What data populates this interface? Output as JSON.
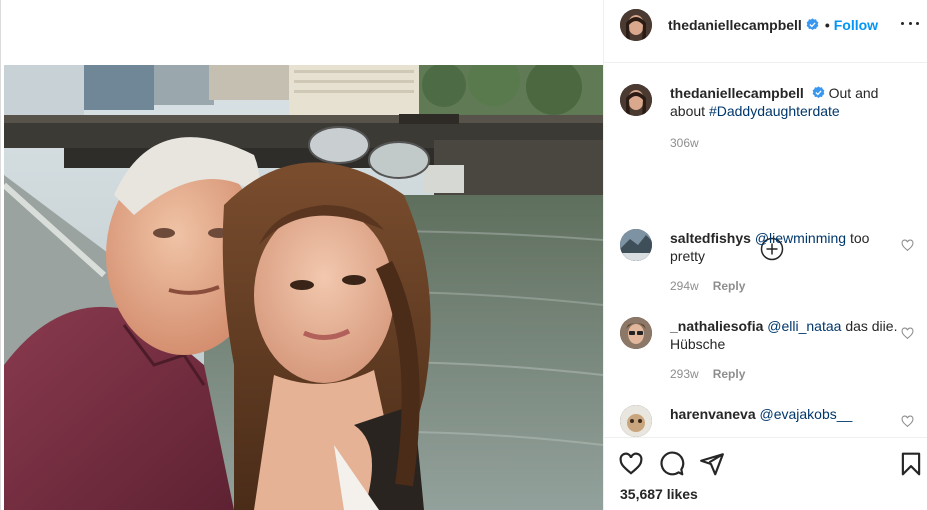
{
  "post": {
    "username": "thedaniellecampbell",
    "follow_label": "Follow",
    "separator": "•",
    "caption_text": "Out and about",
    "caption_tag": "#Daddydaughterdate",
    "caption_time": "306w",
    "likes": "35,687 likes"
  },
  "comments": [
    {
      "user": "saltedfishys",
      "mention": "@liewminming",
      "text": "too pretty",
      "time": "294w",
      "reply": "Reply"
    },
    {
      "user": "_nathaliesofia",
      "mention": "@elli_nataa",
      "text": "das diie. Hübsche",
      "time": "293w",
      "reply": "Reply"
    },
    {
      "user": "harenvaneva",
      "mention": "@evajakobs__",
      "text": "",
      "time": "",
      "reply": ""
    }
  ],
  "icons": {
    "more": "more-options-icon",
    "verified": "verified-badge-icon",
    "load_more": "plus-circle-icon",
    "like": "heart-icon",
    "comment": "comment-icon",
    "share": "send-icon",
    "save": "bookmark-icon"
  },
  "colors": {
    "accent": "#0095f6",
    "mention": "#00376b",
    "muted": "#8e8e8e",
    "text": "#262626"
  }
}
